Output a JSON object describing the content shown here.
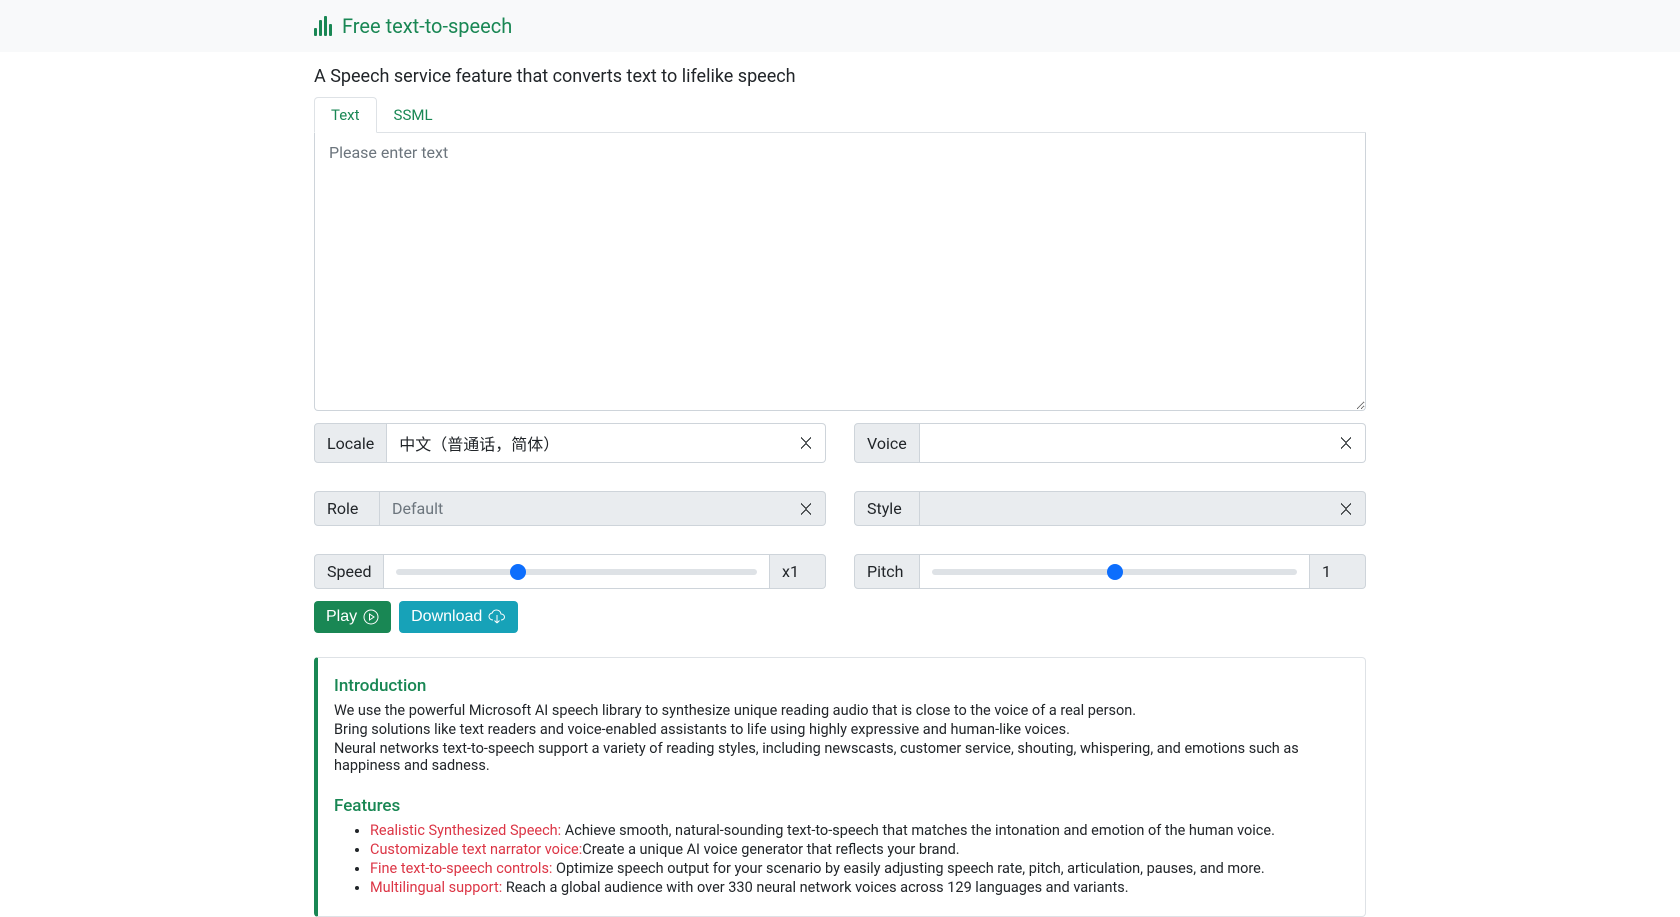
{
  "header": {
    "brand": "Free text-to-speech"
  },
  "subtitle": "A Speech service feature that converts text to lifelike speech",
  "tabs": {
    "text": "Text",
    "ssml": "SSML"
  },
  "textarea": {
    "placeholder": "Please enter text",
    "value": ""
  },
  "controls": {
    "locale": {
      "label": "Locale",
      "value": "中文（普通话，简体）"
    },
    "voice": {
      "label": "Voice",
      "value": ""
    },
    "role": {
      "label": "Role",
      "value": "Default"
    },
    "style": {
      "label": "Style",
      "value": ""
    },
    "speed": {
      "label": "Speed",
      "display": "x1",
      "value": 33
    },
    "pitch": {
      "label": "Pitch",
      "display": "1",
      "value": 50
    }
  },
  "buttons": {
    "play": "Play",
    "download": "Download"
  },
  "info": {
    "intro_heading": "Introduction",
    "intro_p1": "We use the powerful Microsoft AI speech library to synthesize unique reading audio that is close to the voice of a real person.",
    "intro_p2": "Bring solutions like text readers and voice-enabled assistants to life using highly expressive and human-like voices.",
    "intro_p3": "Neural networks text-to-speech support a variety of reading styles, including newscasts, customer service, shouting, whispering, and emotions such as happiness and sadness.",
    "features_heading": "Features",
    "features": [
      {
        "label": "Realistic Synthesized Speech:",
        "text": " Achieve smooth, natural-sounding text-to-speech that matches the intonation and emotion of the human voice."
      },
      {
        "label": "Customizable text narrator voice:",
        "text": "Create a unique AI voice generator that reflects your brand."
      },
      {
        "label": "Fine text-to-speech controls:",
        "text": " Optimize speech output for your scenario by easily adjusting speech rate, pitch, articulation, pauses, and more."
      },
      {
        "label": "Multilingual support:",
        "text": " Reach a global audience with over 330 neural network voices across 129 languages and variants."
      }
    ]
  }
}
